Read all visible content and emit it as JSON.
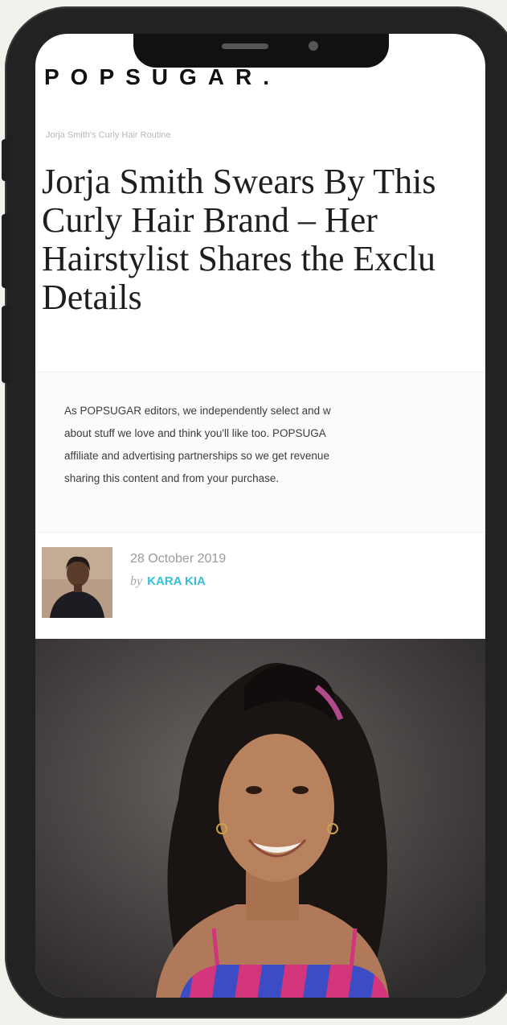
{
  "site": {
    "logo": "POPSUGAR."
  },
  "article": {
    "breadcrumb": "Jorja Smith's Curly Hair Routine",
    "headline_lines": [
      "Jorja Smith Swears By This",
      "Curly Hair Brand – Her",
      "Hairstylist Shares the Exclu",
      "Details"
    ],
    "disclaimer_lines": [
      "As POPSUGAR editors, we independently select and w",
      "about stuff we love and think you'll like too. POPSUGA",
      "affiliate and advertising partnerships so we get revenue",
      "sharing this content and from your purchase."
    ],
    "date": "28 October 2019",
    "by_label": "by",
    "author": "KARA KIA"
  },
  "icons": {
    "avatar": "author-avatar",
    "hero": "hero-photo"
  },
  "colors": {
    "author_link": "#36c0d8",
    "phone_frame": "#222223",
    "background": "#f3f1ec"
  }
}
